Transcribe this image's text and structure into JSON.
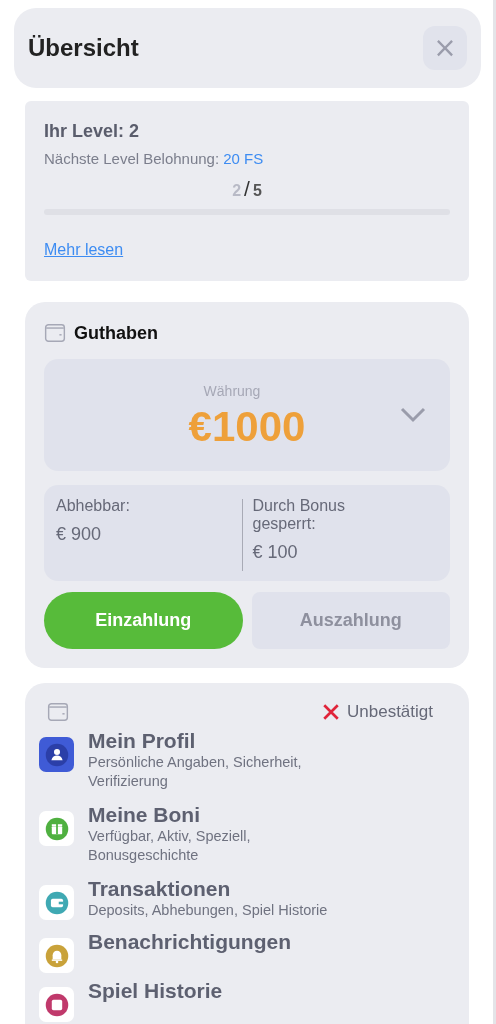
{
  "header": {
    "title": "Übersicht",
    "close_label": "×"
  },
  "level_card": {
    "title": "Ihr Level: 2",
    "reward_label": "Nächste Level Belohnung:",
    "reward_value": "20 FS",
    "progress_current": "2",
    "progress_separator": "/",
    "progress_total": "5",
    "level": 0,
    "link": "Mehr lesen"
  },
  "balance_card": {
    "title": "Guthaben",
    "currency_label": "Währung",
    "amount": "€1000",
    "withdrawable_label": "Abhebbar:",
    "withdrawable_value": "€ 900",
    "locked_label": "Durch Bonus gesperrt:",
    "locked_value": "€ 100",
    "buttons": [
      {
        "label": "Einzahlung",
        "disabled": false
      },
      {
        "label": "Auszahlung",
        "disabled": true
      }
    ]
  },
  "menu_card": {
    "status": "Unbestätigt",
    "verified": false,
    "items": [
      {
        "kind": "profile",
        "title": "Mein Profil",
        "subtitle": "Persönliche Angaben, Sicherheit, Verifizierung",
        "color": "#3f5bd6"
      },
      {
        "kind": "gift",
        "title": "Meine Boni",
        "subtitle": "Verfügbar, Aktiv, Speziell, Bonusgeschichte",
        "color": "#4fb040"
      },
      {
        "kind": "wallet",
        "title": "Transaktionen",
        "subtitle": "Deposits, Abhebungen, Spiel Historie",
        "color": "#3fa9b3"
      },
      {
        "kind": "bell",
        "title": "Benachrichtigungen",
        "color": "#c9a23a"
      },
      {
        "kind": "dice",
        "title": "Spiel Historie",
        "color": "#c0396b"
      }
    ]
  }
}
